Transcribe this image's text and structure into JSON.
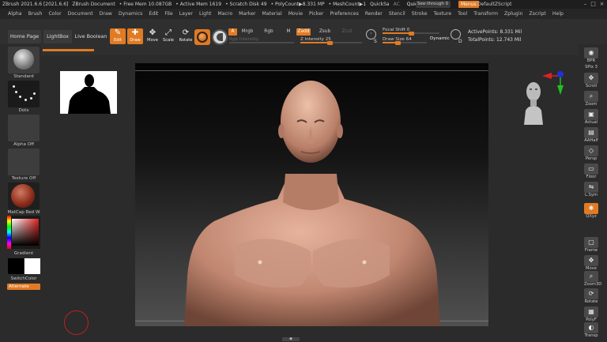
{
  "titlebar": {
    "app": "ZBrush 2021.6.6 [2021.6.6]",
    "doc": "ZBrush Document",
    "free_mem": "• Free Mem 10.087GB",
    "active_mem": "• Active Mem 1619",
    "scratch": "• Scratch Disk 49",
    "polycount": "• PolyCount▶8.331 MP",
    "meshcount": "• MeshCount▶1",
    "quicksave_short": "QuickSa",
    "ac": "AC",
    "quicksave": "QuickSave",
    "see_through": "See-through 0",
    "menus": "Menus",
    "default_zscript": "DefaultZScript",
    "ctl_min": "–",
    "ctl_max": "□",
    "ctl_close": "×"
  },
  "menubar": [
    "Alpha",
    "Brush",
    "Color",
    "Document",
    "Draw",
    "Dynamics",
    "Edit",
    "File",
    "Layer",
    "Light",
    "Macro",
    "Marker",
    "Material",
    "Movie",
    "Picker",
    "Preferences",
    "Render",
    "Stencil",
    "Stroke",
    "Texture",
    "Tool",
    "Transform",
    "Zplugin",
    "Zscript",
    "Help"
  ],
  "shelf": {
    "home_page": "Home Page",
    "lightbox": "LightBox",
    "live_boolean": "Live Boolean",
    "tools": [
      {
        "label": "Edit",
        "icon": "✎",
        "active": true
      },
      {
        "label": "Draw",
        "icon": "✚",
        "active": true
      },
      {
        "label": "Move",
        "icon": "✥",
        "active": false
      },
      {
        "label": "Scale",
        "icon": "⤢",
        "active": false
      },
      {
        "label": "Rotate",
        "icon": "⟳",
        "active": false
      }
    ],
    "mode_a": "A",
    "mrgb": "Mrgb",
    "rgb": "Rgb",
    "m": "M",
    "zadd": "Zadd",
    "zsub": "Zsub",
    "zcut": "Zcut",
    "rgb_intensity": "Rgb Intensity",
    "z_intensity": "Z Intensity 25",
    "z_intensity_value": 25,
    "focal_shift": "Focal Shift 0",
    "draw_size": "Draw Size 64",
    "dynamic": "Dynamic",
    "active_points": "ActivePoints: 8.331 Mil",
    "total_points": "TotalPoints: 12.743 Mil"
  },
  "left_tray": {
    "standard": "Standard",
    "dots": "Dots",
    "alpha_off": "Alpha Off",
    "texture_off": "Texture Off",
    "matcap": "MatCap Red W",
    "gradient": "Gradient",
    "switch_color": "SwitchColor",
    "alternate": "Alternate"
  },
  "right_tray": [
    {
      "label": "BPR",
      "icon": "◉"
    },
    {
      "label": "SPix 3",
      "icon": "▦"
    },
    {
      "label": "Scroll",
      "icon": "✥"
    },
    {
      "label": "Zoom",
      "icon": "⌕"
    },
    {
      "label": "Actual",
      "icon": "▣"
    },
    {
      "label": "AAHalf",
      "icon": "▤"
    },
    {
      "label": "Persp",
      "icon": "◇"
    },
    {
      "label": "Floor",
      "icon": "▭"
    },
    {
      "label": "L.Sym",
      "icon": "⇋"
    },
    {
      "label": "QXyz",
      "icon": "✱"
    },
    {
      "label": "Frame",
      "icon": "▢"
    },
    {
      "label": "Move",
      "icon": "✥"
    },
    {
      "label": "Zoom3D",
      "icon": "⌕"
    },
    {
      "label": "Rotate",
      "icon": "⟳"
    },
    {
      "label": "PolyF",
      "icon": "▦"
    },
    {
      "label": "Transp",
      "icon": "◐"
    }
  ],
  "colors": {
    "accent": "#e07b24",
    "panel": "#2b2b2b",
    "button": "#3a3a3a"
  }
}
